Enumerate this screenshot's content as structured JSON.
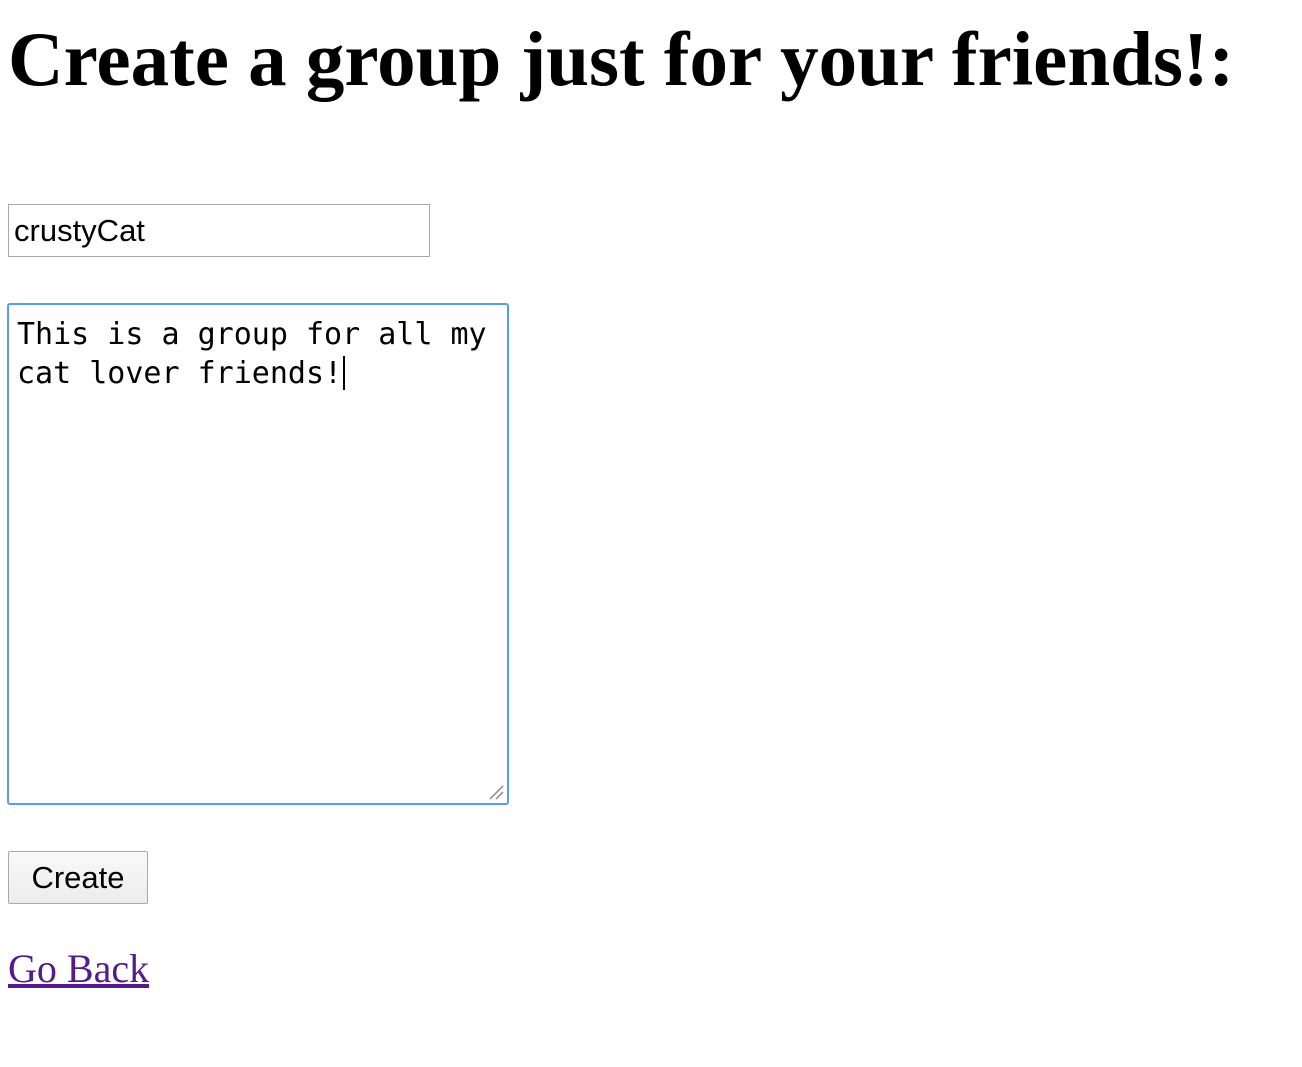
{
  "page": {
    "title": "Create a group just for your friends!:"
  },
  "form": {
    "group_name": {
      "value": "crustyCat"
    },
    "description": {
      "value": "This is a group for all my cat lover friends!"
    },
    "create_label": "Create",
    "go_back_label": "Go Back"
  },
  "colors": {
    "focus_border": "#5b9cf2",
    "visited_link": "#551a8b"
  }
}
